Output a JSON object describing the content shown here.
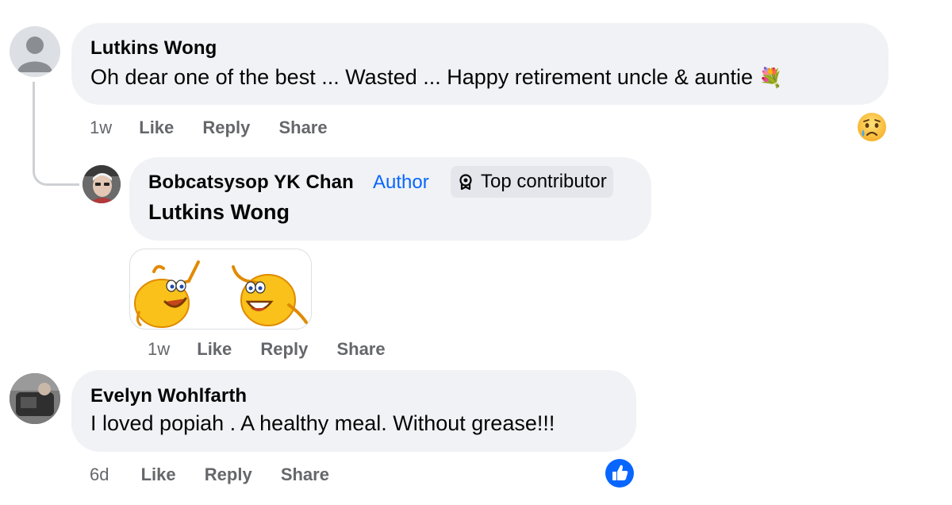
{
  "comments": [
    {
      "author": "Lutkins Wong",
      "text": "Oh dear one of the best ... Wasted ... Happy retirement uncle & auntie",
      "emoji": "💐",
      "time": "1w",
      "actions": {
        "like": "Like",
        "reply": "Reply",
        "share": "Share"
      },
      "reaction_icon": "sad-tear-reaction-icon",
      "reply": {
        "author": "Bobcatsysop YK Chan",
        "author_badge": "Author",
        "contributor_badge": "Top contributor",
        "contributor_icon": "top-contributor-badge-icon",
        "mention": "Lutkins Wong",
        "sticker": "two-dancing-smiley-faces-sticker",
        "time": "1w",
        "actions": {
          "like": "Like",
          "reply": "Reply",
          "share": "Share"
        }
      }
    },
    {
      "author": "Evelyn Wohlfarth",
      "text": "I loved popiah . A healthy meal. Without grease!!!",
      "time": "6d",
      "actions": {
        "like": "Like",
        "reply": "Reply",
        "share": "Share"
      },
      "reaction_icon": "like-reaction-icon"
    }
  ],
  "colors": {
    "bubble": "#f0f2f5",
    "secondary_text": "#65676b",
    "author_blue": "#0866ff",
    "thread_line": "#ced0d4"
  }
}
